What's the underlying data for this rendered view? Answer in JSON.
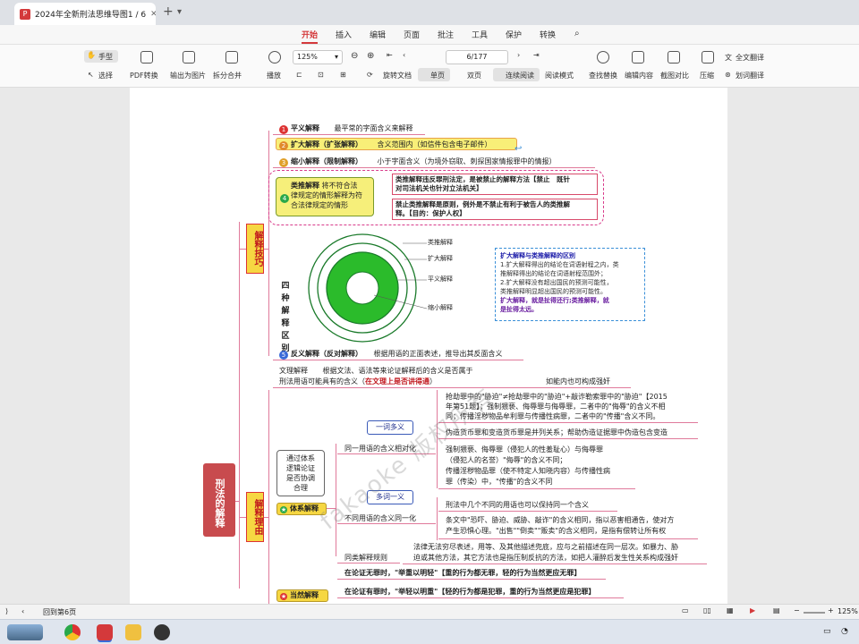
{
  "browser": {
    "tab_title": "2024年全新刑法思维导图1 / 6",
    "tab_icon": "pdf-icon",
    "new_tab_symbol": "+",
    "menu_symbol": "▾"
  },
  "menu": {
    "items": [
      "开始",
      "插入",
      "编辑",
      "页面",
      "批注",
      "工具",
      "保护",
      "转换"
    ],
    "active": "开始"
  },
  "toolbar": {
    "hand": "手型",
    "select": "选择",
    "pdf_convert": "PDF转换",
    "export_image": "输出为图片",
    "split_merge": "拆分合并",
    "play": "播放",
    "zoom": "125%",
    "page_input": "6/177",
    "rotate": "旋转文档",
    "single": "单页",
    "double": "双页",
    "continuous": "连续阅读",
    "read_mode": "阅读模式",
    "find_replace": "查找替换",
    "edit_content": "编辑内容",
    "screenshot_compare": "截图对比",
    "compress": "压缩",
    "full_translate": "全文翻译",
    "word_translate": "划词翻译"
  },
  "mindmap": {
    "root": "刑法的解释",
    "branch_technique": "解释技巧",
    "branch_reason": "解释理由",
    "n1_title": "平义解释",
    "n1_desc": "最平常的字面含义来解释",
    "n2_title": "扩大解释（扩张解释）",
    "n2_desc": "含义范围内（如信件包含电子邮件）",
    "n3_title": "缩小解释（限制解释）",
    "n3_desc": "小于字面含义（为境外窃取、刺探国家情报罪中的情报）",
    "n4_title": "类推解释",
    "n4_desc1": "将不符合法",
    "n4_desc2": "律规定的情形解释为符",
    "n4_desc3": "合法律规定的情形",
    "n4_note1a": "类推解释违反罪刑法定，是被禁止的解释方法【禁止　既针",
    "n4_note1b": "对司法机关也针对立法机关】",
    "n4_note2a": "禁止类推解释是原则，例外是不禁止有利于被告人的类推解",
    "n4_note2b": "释。【目的：保护人权】",
    "n4_flag": "4",
    "circle_side": [
      "四",
      "种",
      "解",
      "释",
      "区",
      "别"
    ],
    "circle_labels": [
      "类推解释",
      "扩大解释",
      "平义解释",
      "缩小解释"
    ],
    "diff_title": "扩大解释与类推解释的区别",
    "diff_1a": "1.扩大解释得出的结论在词语射程之内，类",
    "diff_1b": "推解释得出的结论在词语射程范围外；",
    "diff_2a": "2.扩大解释没有超出国民的预测可能性，",
    "diff_2b": "类推解释明显超出国民的预测可能性。",
    "diff_3a": "扩大解释，就是扯得还行;类推解释，就",
    "diff_3b": "是扯得太远。",
    "n5_title": "反义解释（反对解释）",
    "n5_desc": "根据用语的正面表述，推导出其反面含义",
    "lit_title": "文理解释",
    "lit_desc": "根据文法、语法等来论证解释后的含义是否属于",
    "lit_desc2": "刑法用语可能具有的含义（",
    "lit_hl": "在文理上是否讲得通",
    "lit_end": "）",
    "lit_note": "如能内也可构成强奸",
    "sys_box": [
      "通过体系",
      "逻辑论证",
      "是否协调",
      "合理"
    ],
    "sys_title": "体系解释",
    "tag_one_many": "一词多义",
    "tag_many_one": "多词一义",
    "same_term": "同一用语的含义相对化",
    "ex1a": "抢劫罪中的\"胁迫\"≠抢劫罪中的\"胁迫\"+敲诈勒索罪中的\"胁迫\"【2015",
    "ex1b": "年第51题】；强制猥亵、侮辱罪与侮辱罪，二者中的\"侮辱\"的含义不相",
    "ex1c": "同；传播淫秽物品牟利罪与传播性病罪，二者中的\"传播\"含义不同。",
    "ex2": "伪造货币罪和变造货币罪是并列关系；帮助伪造证据罪中伪造包含变造",
    "ex3a": "强制猥亵、侮辱罪（侵犯人的性羞耻心）与侮辱罪",
    "ex3b": "（侵犯人的名誉）\"侮辱\"的含义不同；",
    "ex3c": "传播淫秽物品罪（使不特定人知晓内容）与传播性病",
    "ex3d": "罪（传染）中，\"传播\"的含义不同",
    "diff_term": "不同用语的含义同一化",
    "ex4": "刑法中几个不同的用语也可以保持同一个含义",
    "ex5a": "条文中\"恐吓、胁迫、威胁、敲诈\"的含义相同，指以恶害相通告，使对方",
    "ex5b": "产生恐惧心理。\"出售\"\"倒卖\"\"贩卖\"的含义相同，是指有偿转让所有权",
    "same_rule": "同类解释规则",
    "ex6a": "法律无法穷尽表述，用等、及其他描述兜底，应与之前描述在同一层次。如暴力、胁",
    "ex6b": "迫或其他方法，其它方法也是指压制反抗的方法，如把人灌醉后发生性关系构成强奸",
    "rule1": "在论证无罪时，\"举重以明轻\"【重的行为都无罪，轻的行为当然更应无罪】",
    "nat_title": "当然解释",
    "rule2": "在论证有罪时，\"举轻以明重\"【轻的行为都是犯罪，重的行为当然更应是犯罪】",
    "watermark": "fakaoke 版权所有"
  },
  "status": {
    "page_label": "回到第6页",
    "zoom": "125%"
  },
  "taskbar": {
    "apps": [
      "city-thumb-icon",
      "chrome-icon",
      "pdf-app-icon",
      "explorer-icon",
      "obs-icon"
    ]
  },
  "colors": {
    "accent": "#d4393b",
    "label_yellow": "#f6d742",
    "root_red": "#c84b4e",
    "diff_blue": "#3a8fd8"
  }
}
